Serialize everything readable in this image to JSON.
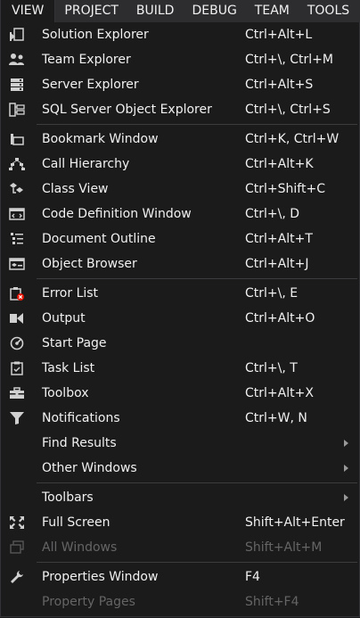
{
  "menubar": {
    "items": [
      {
        "label": "VIEW",
        "active": true
      },
      {
        "label": "PROJECT"
      },
      {
        "label": "BUILD"
      },
      {
        "label": "DEBUG"
      },
      {
        "label": "TEAM"
      },
      {
        "label": "TOOLS"
      }
    ]
  },
  "menu": {
    "groups": [
      {
        "items": [
          {
            "label": "Solution Explorer",
            "shortcut": "Ctrl+Alt+L",
            "icon": "solution-explorer-icon"
          },
          {
            "label": "Team Explorer",
            "shortcut": "Ctrl+\\, Ctrl+M",
            "icon": "team-explorer-icon"
          },
          {
            "label": "Server Explorer",
            "shortcut": "Ctrl+Alt+S",
            "icon": "server-explorer-icon"
          },
          {
            "label": "SQL Server Object Explorer",
            "shortcut": "Ctrl+\\, Ctrl+S",
            "icon": "sql-server-icon"
          }
        ]
      },
      {
        "items": [
          {
            "label": "Bookmark Window",
            "shortcut": "Ctrl+K, Ctrl+W",
            "icon": "bookmark-icon"
          },
          {
            "label": "Call Hierarchy",
            "shortcut": "Ctrl+Alt+K",
            "icon": "call-hierarchy-icon"
          },
          {
            "label": "Class View",
            "shortcut": "Ctrl+Shift+C",
            "icon": "class-view-icon"
          },
          {
            "label": "Code Definition Window",
            "shortcut": "Ctrl+\\, D",
            "icon": "code-definition-icon"
          },
          {
            "label": "Document Outline",
            "shortcut": "Ctrl+Alt+T",
            "icon": "document-outline-icon"
          },
          {
            "label": "Object Browser",
            "shortcut": "Ctrl+Alt+J",
            "icon": "object-browser-icon"
          }
        ]
      },
      {
        "items": [
          {
            "label": "Error List",
            "shortcut": "Ctrl+\\, E",
            "icon": "error-list-icon"
          },
          {
            "label": "Output",
            "shortcut": "Ctrl+Alt+O",
            "icon": "output-icon"
          },
          {
            "label": "Start Page",
            "shortcut": "",
            "icon": "start-page-icon"
          },
          {
            "label": "Task List",
            "shortcut": "Ctrl+\\, T",
            "icon": "task-list-icon"
          },
          {
            "label": "Toolbox",
            "shortcut": "Ctrl+Alt+X",
            "icon": "toolbox-icon"
          },
          {
            "label": "Notifications",
            "shortcut": "Ctrl+W, N",
            "icon": "notifications-icon"
          },
          {
            "label": "Find Results",
            "shortcut": "",
            "submenu": true
          },
          {
            "label": "Other Windows",
            "shortcut": "",
            "submenu": true
          }
        ]
      },
      {
        "items": [
          {
            "label": "Toolbars",
            "shortcut": "",
            "submenu": true
          },
          {
            "label": "Full Screen",
            "shortcut": "Shift+Alt+Enter",
            "icon": "full-screen-icon"
          },
          {
            "label": "All Windows",
            "shortcut": "Shift+Alt+M",
            "icon": "all-windows-icon",
            "disabled": true
          }
        ]
      },
      {
        "items": [
          {
            "label": "Properties Window",
            "shortcut": "F4",
            "icon": "wrench-icon"
          },
          {
            "label": "Property Pages",
            "shortcut": "Shift+F4",
            "disabled": true
          }
        ]
      }
    ]
  },
  "colors": {
    "menubar_bg": "#2d2d30",
    "menu_bg": "#1b1b1c",
    "text": "#f1f1f1",
    "disabled_text": "#656565",
    "separator": "#3c3c3f",
    "icon": "#d0d0d0",
    "error_red": "#e51400",
    "accent_blue": "#3399ff"
  }
}
